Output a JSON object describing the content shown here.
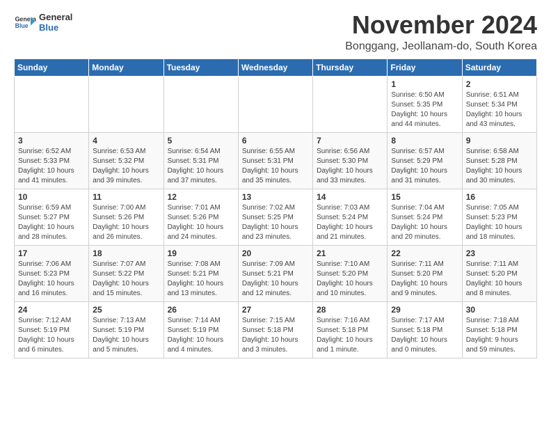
{
  "header": {
    "logo_line1": "General",
    "logo_line2": "Blue",
    "month_title": "November 2024",
    "subtitle": "Bonggang, Jeollanam-do, South Korea"
  },
  "weekdays": [
    "Sunday",
    "Monday",
    "Tuesday",
    "Wednesday",
    "Thursday",
    "Friday",
    "Saturday"
  ],
  "weeks": [
    [
      {
        "day": "",
        "info": ""
      },
      {
        "day": "",
        "info": ""
      },
      {
        "day": "",
        "info": ""
      },
      {
        "day": "",
        "info": ""
      },
      {
        "day": "",
        "info": ""
      },
      {
        "day": "1",
        "info": "Sunrise: 6:50 AM\nSunset: 5:35 PM\nDaylight: 10 hours\nand 44 minutes."
      },
      {
        "day": "2",
        "info": "Sunrise: 6:51 AM\nSunset: 5:34 PM\nDaylight: 10 hours\nand 43 minutes."
      }
    ],
    [
      {
        "day": "3",
        "info": "Sunrise: 6:52 AM\nSunset: 5:33 PM\nDaylight: 10 hours\nand 41 minutes."
      },
      {
        "day": "4",
        "info": "Sunrise: 6:53 AM\nSunset: 5:32 PM\nDaylight: 10 hours\nand 39 minutes."
      },
      {
        "day": "5",
        "info": "Sunrise: 6:54 AM\nSunset: 5:31 PM\nDaylight: 10 hours\nand 37 minutes."
      },
      {
        "day": "6",
        "info": "Sunrise: 6:55 AM\nSunset: 5:31 PM\nDaylight: 10 hours\nand 35 minutes."
      },
      {
        "day": "7",
        "info": "Sunrise: 6:56 AM\nSunset: 5:30 PM\nDaylight: 10 hours\nand 33 minutes."
      },
      {
        "day": "8",
        "info": "Sunrise: 6:57 AM\nSunset: 5:29 PM\nDaylight: 10 hours\nand 31 minutes."
      },
      {
        "day": "9",
        "info": "Sunrise: 6:58 AM\nSunset: 5:28 PM\nDaylight: 10 hours\nand 30 minutes."
      }
    ],
    [
      {
        "day": "10",
        "info": "Sunrise: 6:59 AM\nSunset: 5:27 PM\nDaylight: 10 hours\nand 28 minutes."
      },
      {
        "day": "11",
        "info": "Sunrise: 7:00 AM\nSunset: 5:26 PM\nDaylight: 10 hours\nand 26 minutes."
      },
      {
        "day": "12",
        "info": "Sunrise: 7:01 AM\nSunset: 5:26 PM\nDaylight: 10 hours\nand 24 minutes."
      },
      {
        "day": "13",
        "info": "Sunrise: 7:02 AM\nSunset: 5:25 PM\nDaylight: 10 hours\nand 23 minutes."
      },
      {
        "day": "14",
        "info": "Sunrise: 7:03 AM\nSunset: 5:24 PM\nDaylight: 10 hours\nand 21 minutes."
      },
      {
        "day": "15",
        "info": "Sunrise: 7:04 AM\nSunset: 5:24 PM\nDaylight: 10 hours\nand 20 minutes."
      },
      {
        "day": "16",
        "info": "Sunrise: 7:05 AM\nSunset: 5:23 PM\nDaylight: 10 hours\nand 18 minutes."
      }
    ],
    [
      {
        "day": "17",
        "info": "Sunrise: 7:06 AM\nSunset: 5:23 PM\nDaylight: 10 hours\nand 16 minutes."
      },
      {
        "day": "18",
        "info": "Sunrise: 7:07 AM\nSunset: 5:22 PM\nDaylight: 10 hours\nand 15 minutes."
      },
      {
        "day": "19",
        "info": "Sunrise: 7:08 AM\nSunset: 5:21 PM\nDaylight: 10 hours\nand 13 minutes."
      },
      {
        "day": "20",
        "info": "Sunrise: 7:09 AM\nSunset: 5:21 PM\nDaylight: 10 hours\nand 12 minutes."
      },
      {
        "day": "21",
        "info": "Sunrise: 7:10 AM\nSunset: 5:20 PM\nDaylight: 10 hours\nand 10 minutes."
      },
      {
        "day": "22",
        "info": "Sunrise: 7:11 AM\nSunset: 5:20 PM\nDaylight: 10 hours\nand 9 minutes."
      },
      {
        "day": "23",
        "info": "Sunrise: 7:11 AM\nSunset: 5:20 PM\nDaylight: 10 hours\nand 8 minutes."
      }
    ],
    [
      {
        "day": "24",
        "info": "Sunrise: 7:12 AM\nSunset: 5:19 PM\nDaylight: 10 hours\nand 6 minutes."
      },
      {
        "day": "25",
        "info": "Sunrise: 7:13 AM\nSunset: 5:19 PM\nDaylight: 10 hours\nand 5 minutes."
      },
      {
        "day": "26",
        "info": "Sunrise: 7:14 AM\nSunset: 5:19 PM\nDaylight: 10 hours\nand 4 minutes."
      },
      {
        "day": "27",
        "info": "Sunrise: 7:15 AM\nSunset: 5:18 PM\nDaylight: 10 hours\nand 3 minutes."
      },
      {
        "day": "28",
        "info": "Sunrise: 7:16 AM\nSunset: 5:18 PM\nDaylight: 10 hours\nand 1 minute."
      },
      {
        "day": "29",
        "info": "Sunrise: 7:17 AM\nSunset: 5:18 PM\nDaylight: 10 hours\nand 0 minutes."
      },
      {
        "day": "30",
        "info": "Sunrise: 7:18 AM\nSunset: 5:18 PM\nDaylight: 9 hours\nand 59 minutes."
      }
    ]
  ]
}
